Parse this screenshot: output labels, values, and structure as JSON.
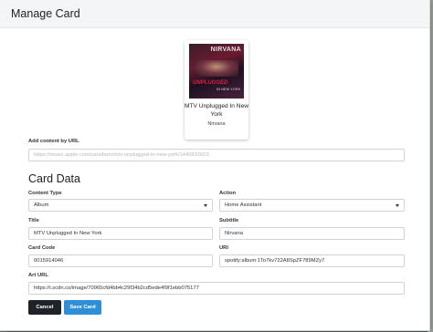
{
  "modal": {
    "title": "Manage Card"
  },
  "preview": {
    "art_logo": "NIRVANA",
    "art_title": "UNPLUGGED",
    "art_subtitle": "IN NEW YORK",
    "title": "MTV Unplugged In New York",
    "subtitle": "Nirvana"
  },
  "add_by_url": {
    "label": "Add content by URL",
    "value": "https://music.apple.com/us/album/mtv-unplugged-in-new-york/1440831603"
  },
  "card_data": {
    "heading": "Card Data",
    "content_type": {
      "label": "Content Type",
      "value": "Album"
    },
    "action": {
      "label": "Action",
      "value": "Home Assistant"
    },
    "title": {
      "label": "Title",
      "value": "MTV Unplugged In New York"
    },
    "subtitle": {
      "label": "Subtitle",
      "value": "Nirvana"
    },
    "card_code": {
      "label": "Card Code",
      "value": "0015914046"
    },
    "uri": {
      "label": "URI",
      "value": "spotify:album:1To7kv722A8SpZF789MZy7"
    },
    "art_url": {
      "label": "Art URL",
      "value": "https://i.scdn.co/image/70965cfd4bb4c29f34b2cd5ede4f9f1ebb075177"
    }
  },
  "buttons": {
    "cancel": "Cancel",
    "save": "Save Card"
  },
  "colors": {
    "save_button": "#2f8fd6",
    "cancel_button": "#1f2328"
  }
}
